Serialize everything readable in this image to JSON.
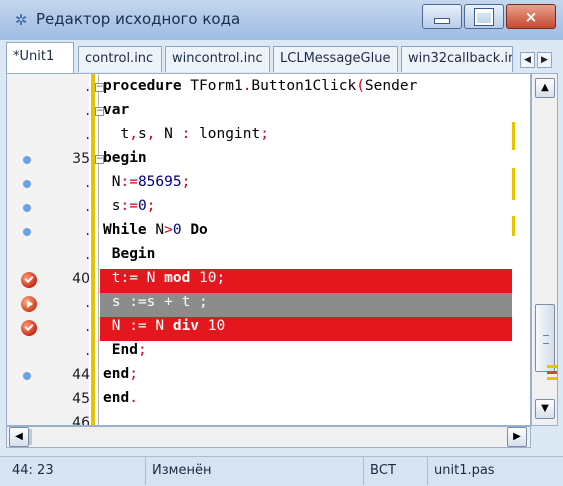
{
  "window": {
    "title": "Редактор исходного кода",
    "icon": "gear-icon",
    "controls": {
      "minimize": "minimize-icon",
      "maximize": "maximize-icon",
      "close": "×"
    }
  },
  "tabs": [
    {
      "label": "*Unit1",
      "active": true
    },
    {
      "label": "control.inc",
      "active": false
    },
    {
      "label": "wincontrol.inc",
      "active": false
    },
    {
      "label": "LCLMessageGlue",
      "active": false
    },
    {
      "label": "win32callback.ir",
      "active": false
    }
  ],
  "tab_scroll": {
    "left": "◀",
    "right": "▶"
  },
  "editor": {
    "lines": [
      {
        "gutter": ".",
        "mark": "none",
        "fold": "−",
        "parts": [
          [
            "kw",
            "procedure"
          ],
          [
            "t",
            " TForm1"
          ],
          [
            "sym",
            "."
          ],
          [
            "t",
            "Button1Click"
          ],
          [
            "sym",
            "("
          ],
          [
            "t",
            "Sender"
          ]
        ]
      },
      {
        "gutter": ".",
        "mark": "none",
        "fold": "−",
        "parts": [
          [
            "kw",
            "var"
          ]
        ]
      },
      {
        "gutter": ".",
        "mark": "none",
        "fold": "",
        "parts": [
          [
            "t",
            "  t"
          ],
          [
            "sym",
            ","
          ],
          [
            "t",
            "s"
          ],
          [
            "sym",
            ","
          ],
          [
            "t",
            " N "
          ],
          [
            "sym",
            ":"
          ],
          [
            "t",
            " longint"
          ],
          [
            "sym",
            ";"
          ]
        ]
      },
      {
        "gutter": "35",
        "mark": "dot",
        "fold": "−",
        "parts": [
          [
            "kw",
            "begin"
          ]
        ]
      },
      {
        "gutter": ".",
        "mark": "dot",
        "fold": "",
        "parts": [
          [
            "t",
            " N"
          ],
          [
            "sym",
            ":="
          ],
          [
            "num",
            "85695"
          ],
          [
            "sym",
            ";"
          ]
        ]
      },
      {
        "gutter": ".",
        "mark": "dot",
        "fold": "",
        "parts": [
          [
            "t",
            " s"
          ],
          [
            "sym",
            ":="
          ],
          [
            "num",
            "0"
          ],
          [
            "sym",
            ";"
          ]
        ]
      },
      {
        "gutter": ".",
        "mark": "dot",
        "fold": "",
        "parts": [
          [
            "kw",
            "While"
          ],
          [
            "t",
            " N"
          ],
          [
            "sym",
            ">"
          ],
          [
            "num",
            "0"
          ],
          [
            "t",
            " "
          ],
          [
            "kw",
            "Do"
          ]
        ]
      },
      {
        "gutter": ".",
        "mark": "none",
        "fold": "",
        "parts": [
          [
            "t",
            " "
          ],
          [
            "kw",
            "Begin"
          ]
        ]
      },
      {
        "gutter": "40",
        "mark": "breakpoint",
        "fold": "",
        "highlight": "red",
        "parts": [
          [
            "t",
            " t:= N "
          ],
          [
            "kw",
            "mod"
          ],
          [
            "t",
            " 10;"
          ]
        ]
      },
      {
        "gutter": ".",
        "mark": "exec",
        "fold": "",
        "highlight": "gray",
        "parts": [
          [
            "t",
            " s :=s + t ;"
          ]
        ]
      },
      {
        "gutter": ".",
        "mark": "breakpoint",
        "fold": "",
        "highlight": "red",
        "parts": [
          [
            "t",
            " N := N "
          ],
          [
            "kw",
            "div"
          ],
          [
            "t",
            " 10"
          ]
        ]
      },
      {
        "gutter": ".",
        "mark": "none",
        "fold": "",
        "parts": [
          [
            "t",
            " "
          ],
          [
            "kw",
            "End"
          ],
          [
            "sym",
            ";"
          ]
        ]
      },
      {
        "gutter": "44",
        "mark": "dot",
        "fold": "",
        "parts": [
          [
            "kw",
            "end"
          ],
          [
            "sym",
            ";"
          ]
        ]
      },
      {
        "gutter": "45",
        "mark": "none",
        "fold": "",
        "parts": [
          [
            "kw",
            "end"
          ],
          [
            "sym",
            "."
          ]
        ]
      },
      {
        "gutter": "46",
        "mark": "none",
        "fold": "",
        "parts": []
      }
    ]
  },
  "scrollbar": {
    "up": "▲",
    "down": "▼",
    "left": "◀",
    "right": "▶"
  },
  "status": {
    "position": "44: 23",
    "modified": "Изменён",
    "mode": "ВСТ",
    "file": "unit1.pas"
  },
  "colors": {
    "breakpoint_line": "#e3171d",
    "exec_line": "#8c8c8c",
    "gutter_bar": "#e6c400"
  }
}
